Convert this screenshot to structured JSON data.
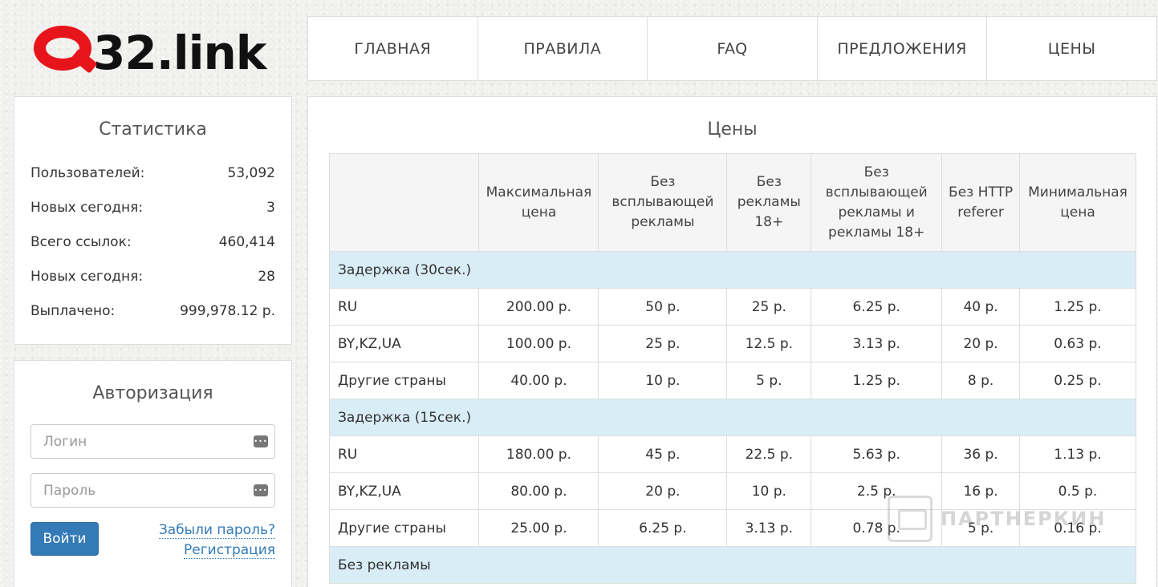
{
  "logo": {
    "letter": "Q",
    "text": "32.link"
  },
  "nav": [
    "ГЛАВНАЯ",
    "ПРАВИЛА",
    "FAQ",
    "ПРЕДЛОЖЕНИЯ",
    "ЦЕНЫ"
  ],
  "stats": {
    "title": "Статистика",
    "rows": [
      {
        "label": "Пользователей:",
        "value": "53,092"
      },
      {
        "label": "Новых сегодня:",
        "value": "3"
      },
      {
        "label": "Всего ссылок:",
        "value": "460,414"
      },
      {
        "label": "Новых сегодня:",
        "value": "28"
      },
      {
        "label": "Выплачено:",
        "value": "999,978.12 р."
      }
    ]
  },
  "auth": {
    "title": "Авторизация",
    "login_placeholder": "Логин",
    "password_placeholder": "Пароль",
    "submit": "Войти",
    "forgot": "Забыли пароль?",
    "register": "Регистрация"
  },
  "prices": {
    "title": "Цены",
    "headers": [
      "",
      "Максимальная цена",
      "Без всплывающей рекламы",
      "Без рекламы 18+",
      "Без всплывающей рекламы и рекламы 18+",
      "Без HTTP referer",
      "Минимальная цена"
    ],
    "groups": [
      {
        "label": "Задержка (30сек.)",
        "rows": [
          [
            "RU",
            "200.00 р.",
            "50 р.",
            "25 р.",
            "6.25 р.",
            "40 р.",
            "1.25 р."
          ],
          [
            "BY,KZ,UA",
            "100.00 р.",
            "25 р.",
            "12.5 р.",
            "3.13 р.",
            "20 р.",
            "0.63 р."
          ],
          [
            "Другие страны",
            "40.00 р.",
            "10 р.",
            "5 р.",
            "1.25 р.",
            "8 р.",
            "0.25 р."
          ]
        ]
      },
      {
        "label": "Задержка (15сек.)",
        "rows": [
          [
            "RU",
            "180.00 р.",
            "45 р.",
            "22.5 р.",
            "5.63 р.",
            "36 р.",
            "1.13 р."
          ],
          [
            "BY,KZ,UA",
            "80.00 р.",
            "20 р.",
            "10 р.",
            "2.5 р.",
            "16 р.",
            "0.5 р."
          ],
          [
            "Другие страны",
            "25.00 р.",
            "6.25 р.",
            "3.13 р.",
            "0.78 р.",
            "5 р.",
            "0.16 р."
          ]
        ]
      },
      {
        "label": "Без рекламы",
        "rows": []
      }
    ]
  },
  "watermark": "ПАРТНЕРКИН"
}
